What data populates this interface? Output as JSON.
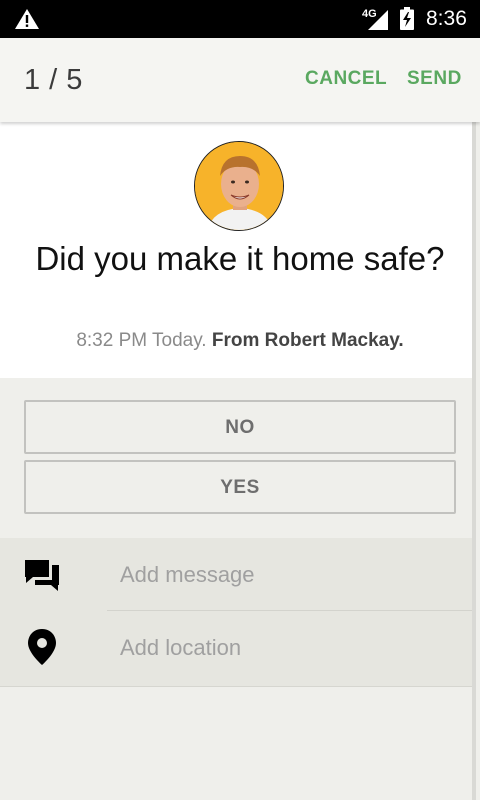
{
  "status_bar": {
    "network": "4G",
    "time": "8:36"
  },
  "header": {
    "counter": "1 / 5",
    "cancel_label": "CANCEL",
    "send_label": "SEND",
    "accent_color": "#5aa860"
  },
  "message": {
    "question": "Did you make it home safe?",
    "time_text": "8:32 PM Today.",
    "from_text": "From Robert Mackay."
  },
  "answers": {
    "no_label": "NO",
    "yes_label": "YES"
  },
  "actions": {
    "message_placeholder": "Add message",
    "location_placeholder": "Add location"
  }
}
